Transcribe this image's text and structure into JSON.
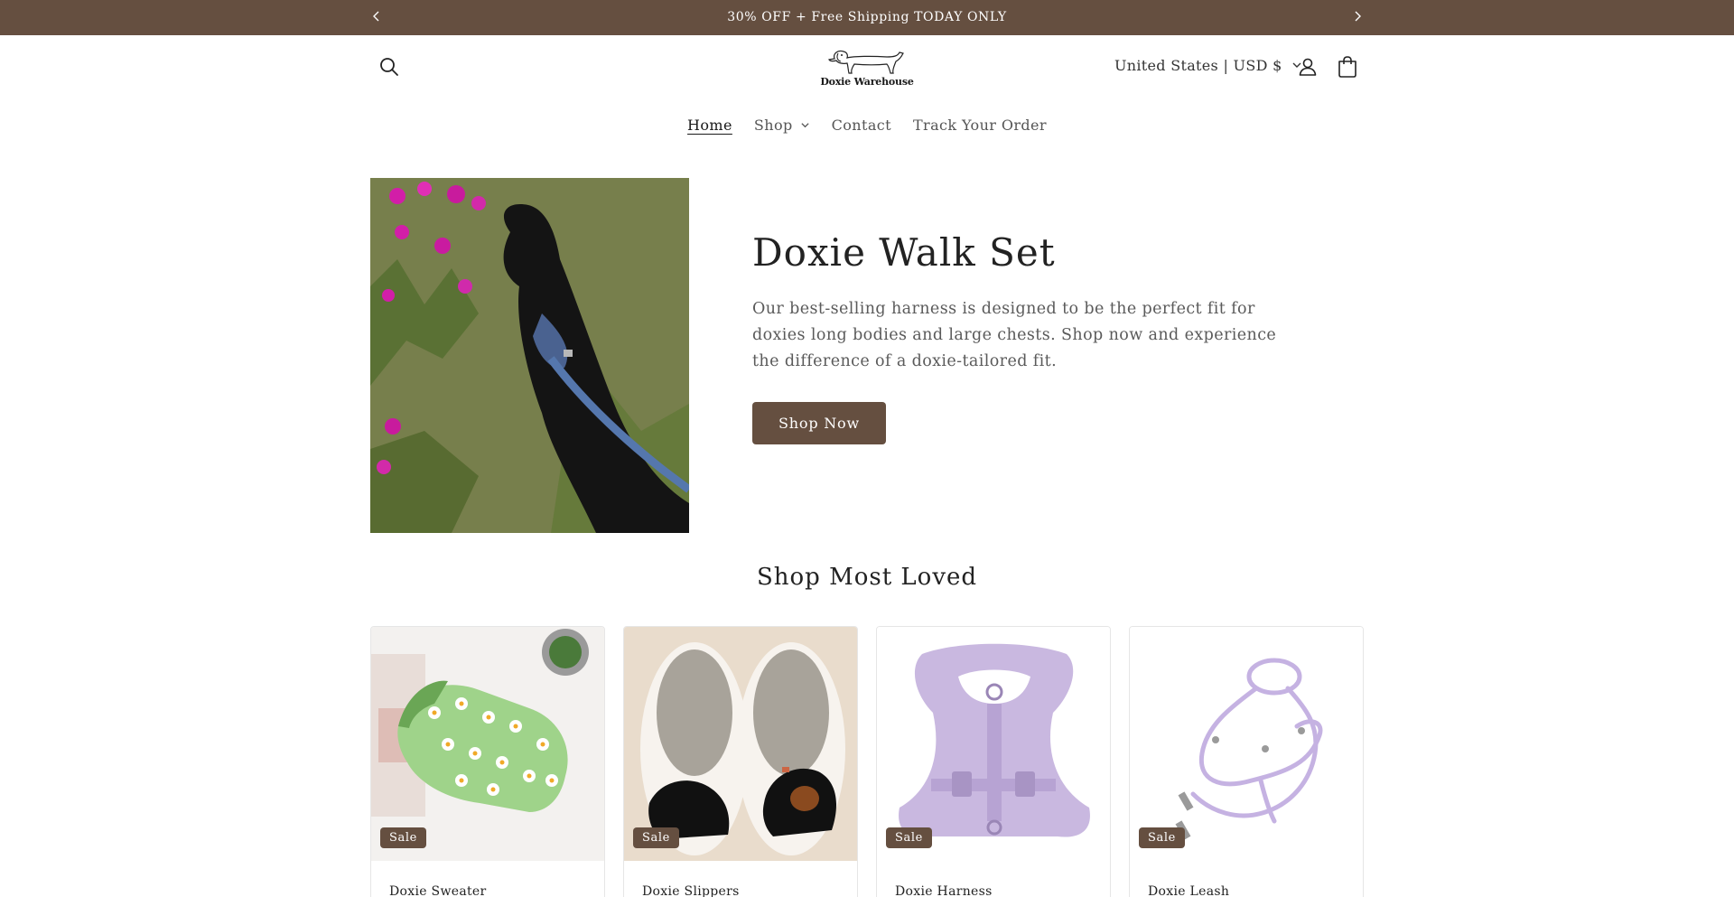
{
  "announcement": {
    "message": "30% OFF + Free Shipping TODAY ONLY",
    "prev_icon": "chevron-left-icon",
    "next_icon": "chevron-right-icon"
  },
  "header": {
    "logo_text": "Doxie Warehouse",
    "locale": "United States | USD $",
    "icons": [
      "search-icon",
      "chevron-down-icon",
      "account-icon",
      "cart-icon"
    ]
  },
  "nav": {
    "items": [
      {
        "label": "Home"
      },
      {
        "label": "Shop"
      },
      {
        "label": "Contact"
      },
      {
        "label": "Track Your Order"
      }
    ]
  },
  "hero": {
    "title": "Doxie Walk Set",
    "description": "Our best-selling harness is designed to be the perfect fit for doxies long bodies and large chests. Shop now and experience the difference of a doxie-tailored fit.",
    "button_label": "Shop Now"
  },
  "section": {
    "title": "Shop Most Loved"
  },
  "products": [
    {
      "name": "Doxie Sweater",
      "badge": "Sale"
    },
    {
      "name": "Doxie Slippers",
      "badge": "Sale"
    },
    {
      "name": "Doxie Harness",
      "badge": "Sale"
    },
    {
      "name": "Doxie Leash",
      "badge": "Sale"
    }
  ],
  "colors": {
    "brand": "#654f40",
    "harness": "#c9b8e0",
    "sweater": "#9fd38a"
  }
}
